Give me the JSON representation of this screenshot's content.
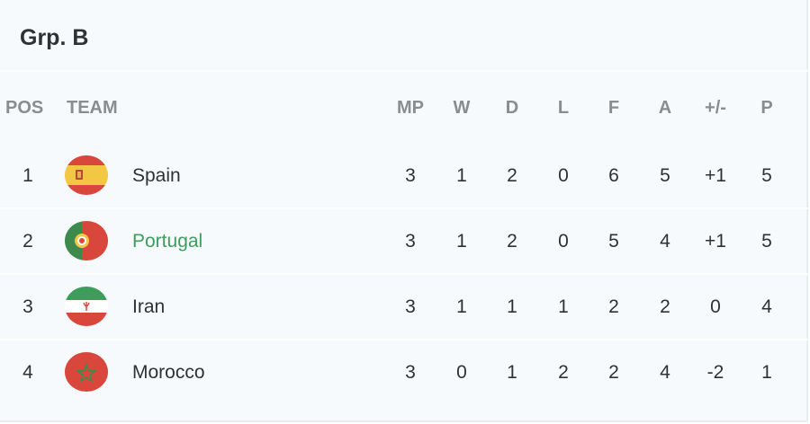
{
  "group": {
    "title": "Grp. B"
  },
  "columns": {
    "pos": "POS",
    "team": "TEAM",
    "mp": "MP",
    "w": "W",
    "d": "D",
    "l": "L",
    "f": "F",
    "a": "A",
    "gd": "+/-",
    "p": "P"
  },
  "rows": [
    {
      "pos": "1",
      "team": "Spain",
      "flag": "spain-flag-icon",
      "mp": "3",
      "w": "1",
      "d": "2",
      "l": "0",
      "f": "6",
      "a": "5",
      "gd": "+1",
      "p": "5"
    },
    {
      "pos": "2",
      "team": "Portugal",
      "flag": "portugal-flag-icon",
      "mp": "3",
      "w": "1",
      "d": "2",
      "l": "0",
      "f": "5",
      "a": "4",
      "gd": "+1",
      "p": "5"
    },
    {
      "pos": "3",
      "team": "Iran",
      "flag": "iran-flag-icon",
      "mp": "3",
      "w": "1",
      "d": "1",
      "l": "1",
      "f": "2",
      "a": "2",
      "gd": "0",
      "p": "4"
    },
    {
      "pos": "4",
      "team": "Morocco",
      "flag": "morocco-flag-icon",
      "mp": "3",
      "w": "0",
      "d": "1",
      "l": "2",
      "f": "2",
      "a": "4",
      "gd": "-2",
      "p": "1"
    }
  ],
  "colors": {
    "highlight_team": "#3e9d5c",
    "header_text": "#8a8c8f",
    "body_text": "#2f3133",
    "background": "#f7fafc"
  }
}
